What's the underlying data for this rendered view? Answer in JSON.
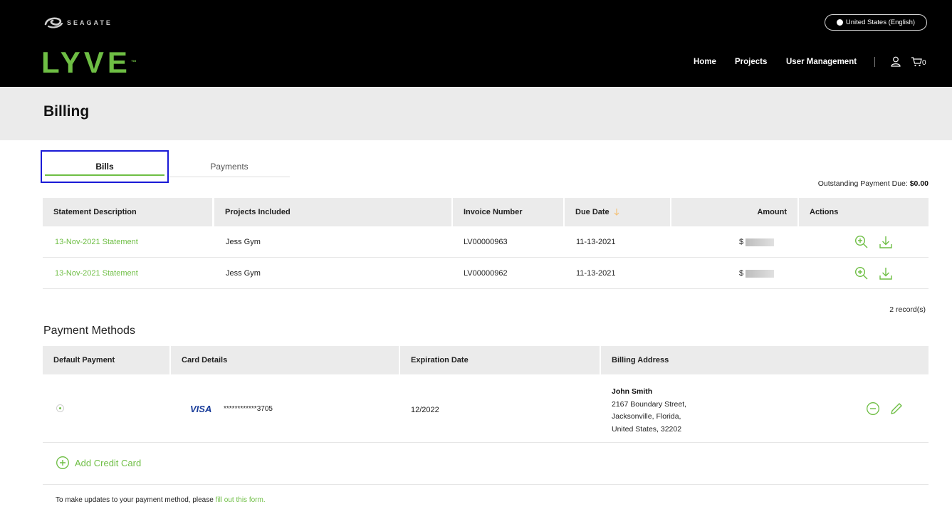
{
  "header": {
    "seagate_text": "SEAGATE",
    "lyve_text": "LYVE",
    "lyve_tm": "™",
    "language": "United States (English)",
    "nav": {
      "home": "Home",
      "projects": "Projects",
      "user_management": "User Management"
    },
    "cart_count": "0"
  },
  "page": {
    "title": "Billing"
  },
  "tabs": {
    "bills": "Bills",
    "payments": "Payments"
  },
  "bills": {
    "outstanding_label": "Outstanding Payment Due:",
    "outstanding_value": "$0.00",
    "columns": {
      "statement": "Statement Description",
      "projects": "Projects Included",
      "invoice": "Invoice Number",
      "due": "Due Date",
      "amount": "Amount",
      "actions": "Actions"
    },
    "rows": [
      {
        "statement": "13-Nov-2021 Statement",
        "projects": "Jess Gym",
        "invoice": "LV00000963",
        "due": "11-13-2021",
        "amount": "$"
      },
      {
        "statement": "13-Nov-2021 Statement",
        "projects": "Jess Gym",
        "invoice": "LV00000962",
        "due": "11-13-2021",
        "amount": "$"
      }
    ],
    "records": "2 record(s)"
  },
  "payment_methods": {
    "title": "Payment Methods",
    "columns": {
      "default": "Default Payment",
      "card": "Card Details",
      "expiration": "Expiration Date",
      "address": "Billing Address"
    },
    "row": {
      "card_brand": "VISA",
      "card_number": "************3705",
      "expiration": "12/2022",
      "address": {
        "name": "John Smith",
        "line1": "2167 Boundary Street,",
        "line2": "Jacksonville, Florida,",
        "line3": "United States, 32202"
      }
    },
    "add_card": "Add Credit Card"
  },
  "footer": {
    "note": "To make updates to your payment method, please ",
    "link": "fill out this form."
  },
  "colors": {
    "accent": "#6ebe44",
    "header_bg": "#000000",
    "band_bg": "#ebebeb",
    "focus": "#1a1ad6"
  }
}
